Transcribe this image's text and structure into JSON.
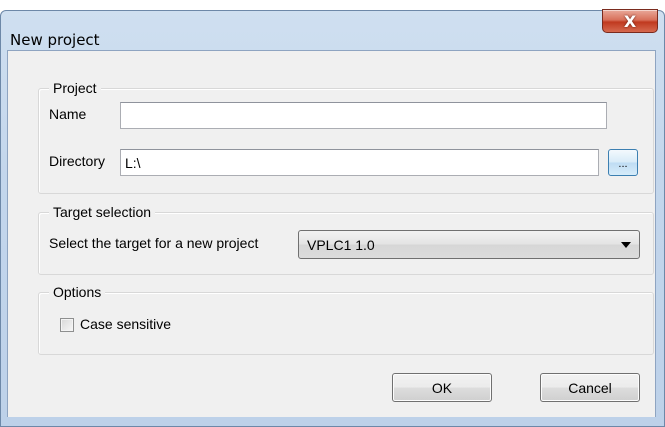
{
  "window": {
    "title": "New project",
    "close_glyph": "X"
  },
  "project_group": {
    "legend": "Project",
    "name_label": "Name",
    "name_value": "",
    "directory_label": "Directory",
    "directory_value": "L:\\",
    "browse_label": "..."
  },
  "target_group": {
    "legend": "Target selection",
    "select_label": "Select the target for a new project",
    "selected_target": "VPLC1 1.0"
  },
  "options_group": {
    "legend": "Options",
    "case_sensitive_label": "Case sensitive",
    "case_sensitive_checked": false
  },
  "buttons": {
    "ok_label": "OK",
    "cancel_label": "Cancel"
  },
  "icons": {
    "close": "close-icon",
    "dropdown": "chevron-down-icon"
  }
}
